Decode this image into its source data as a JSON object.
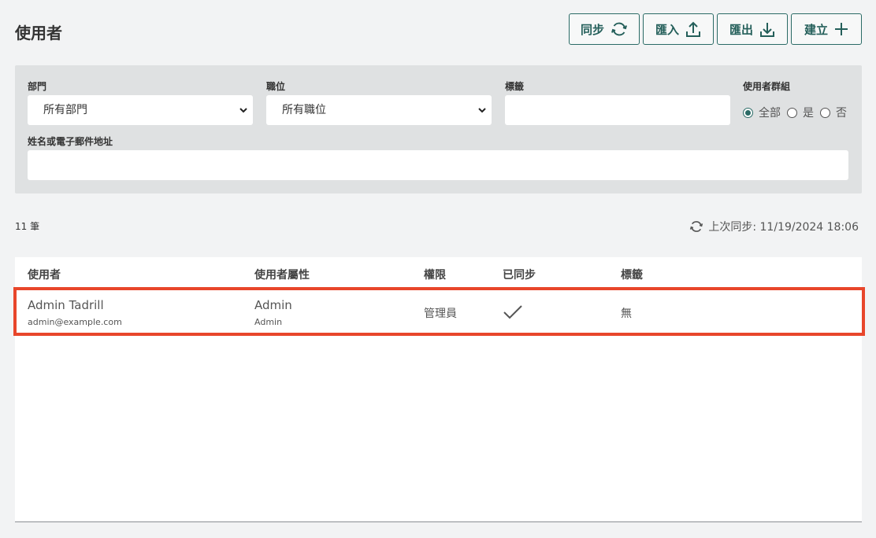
{
  "page": {
    "title": "使用者"
  },
  "toolbar": {
    "sync_label": "同步",
    "import_label": "匯入",
    "export_label": "匯出",
    "create_label": "建立",
    "accent": "#2b6b66"
  },
  "filters": {
    "department": {
      "label": "部門",
      "value": "所有部門"
    },
    "position": {
      "label": "職位",
      "value": "所有職位"
    },
    "tags": {
      "label": "標籤",
      "value": ""
    },
    "user_group": {
      "label": "使用者群組",
      "options": [
        {
          "label": "全部",
          "checked": true
        },
        {
          "label": "是",
          "checked": false
        },
        {
          "label": "否",
          "checked": false
        }
      ]
    },
    "search": {
      "label": "姓名或電子郵件地址",
      "value": ""
    }
  },
  "summary": {
    "count": "11 筆",
    "last_sync": "上次同步: 11/19/2024 18:06"
  },
  "table": {
    "headers": [
      "使用者",
      "使用者屬性",
      "權限",
      "已同步",
      "標籤"
    ],
    "rows": [
      {
        "name": "Admin Tadrill",
        "email": "admin@example.com",
        "attribute": "Admin",
        "attribute_sub": "Admin",
        "permission": "管理員",
        "synced": true,
        "tags": "無"
      }
    ],
    "highlight_color": "#e8462b"
  }
}
